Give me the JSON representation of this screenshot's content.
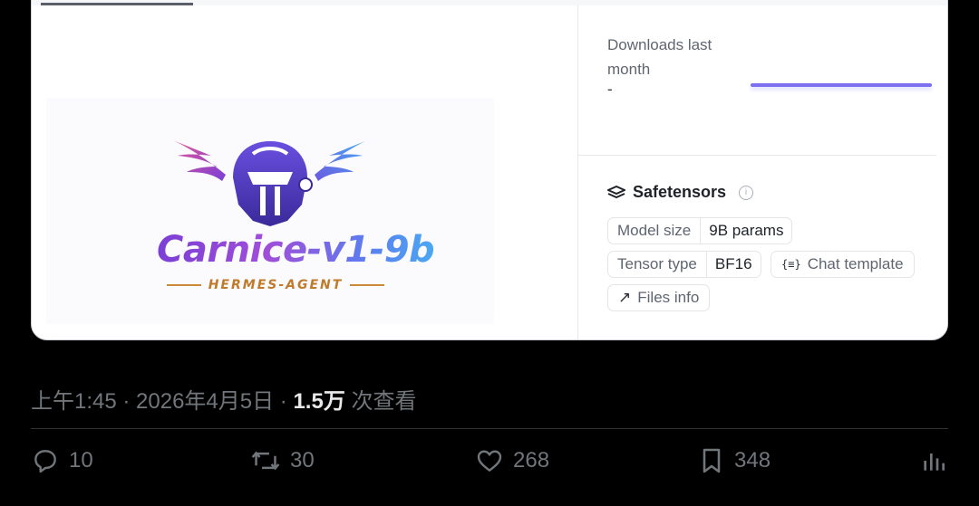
{
  "model_card": {
    "logo": {
      "title": "Carnice-v1-9b",
      "subtitle": "HERMES-AGENT",
      "colors": {
        "primary_purple": "#7b3fd6",
        "wing_pink": "#e0569a",
        "wing_blue": "#4aa8f2",
        "accent_gold": "#c07a2c"
      }
    },
    "downloads": {
      "label": "Downloads last month",
      "value": "-",
      "bar_color": "#7c6ff0"
    },
    "safetensors": {
      "title": "Safetensors",
      "model_size_label": "Model size",
      "model_size_value": "9B params",
      "tensor_type_label": "Tensor type",
      "tensor_type_value": "BF16",
      "chat_template_label": "Chat template",
      "files_info_label": "Files info"
    }
  },
  "tweet": {
    "meta_time_date": "上午1:45 · 2026年4月5日 · ",
    "views_count": "1.5万",
    "views_label": " 次查看",
    "replies": "10",
    "retweets": "30",
    "likes": "268",
    "bookmarks": "348"
  },
  "icons": [
    "safetensors-icon",
    "info-icon",
    "chat-template-icon",
    "arrow-up-right-icon",
    "reply-icon",
    "retweet-icon",
    "like-icon",
    "bookmark-icon",
    "analytics-icon"
  ]
}
